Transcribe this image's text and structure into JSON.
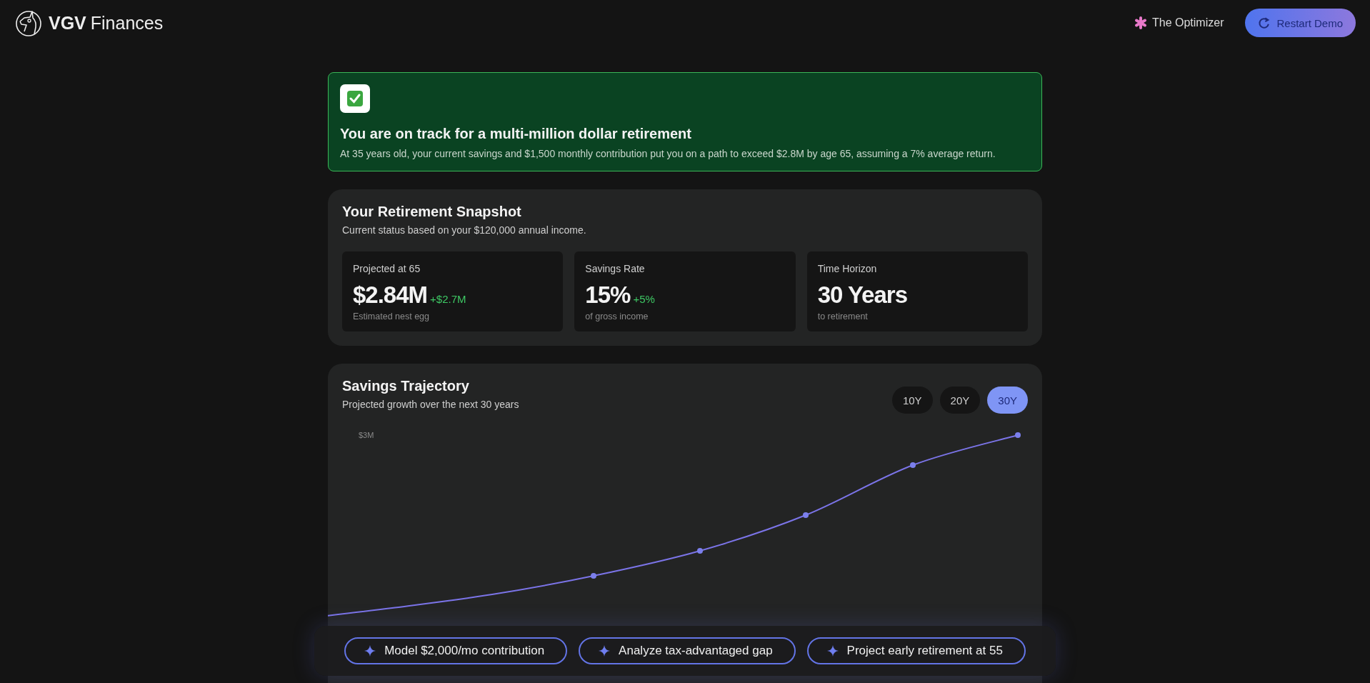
{
  "header": {
    "brand_bold": "VGV",
    "brand_light": "Finances",
    "nav_link": "The Optimizer",
    "restart_button": "Restart Demo"
  },
  "banner": {
    "title": "You are on track for a multi-million dollar retirement",
    "text": "At 35 years old, your current savings and $1,500 monthly contribution put you on a path to exceed $2.8M by age 65, assuming a 7% average return."
  },
  "snapshot": {
    "title": "Your Retirement Snapshot",
    "subtitle": "Current status based on your $120,000 annual income.",
    "stats": [
      {
        "label": "Projected at 65",
        "value": "$2.84M",
        "delta": "+$2.7M",
        "note": "Estimated nest egg"
      },
      {
        "label": "Savings Rate",
        "value": "15%",
        "delta": "+5%",
        "note": "of gross income"
      },
      {
        "label": "Time Horizon",
        "value": "30 Years",
        "note": "to retirement"
      }
    ]
  },
  "trajectory": {
    "title": "Savings Trajectory",
    "subtitle": "Projected growth over the next 30 years",
    "ranges": [
      {
        "label": "10Y",
        "selected": false
      },
      {
        "label": "20Y",
        "selected": false
      },
      {
        "label": "30Y",
        "selected": true
      }
    ],
    "axis_label": "$3M"
  },
  "suggestions": [
    "Model $2,000/mo contribution",
    "Analyze tax-advantaged gap",
    "Project early retirement at 55"
  ]
}
